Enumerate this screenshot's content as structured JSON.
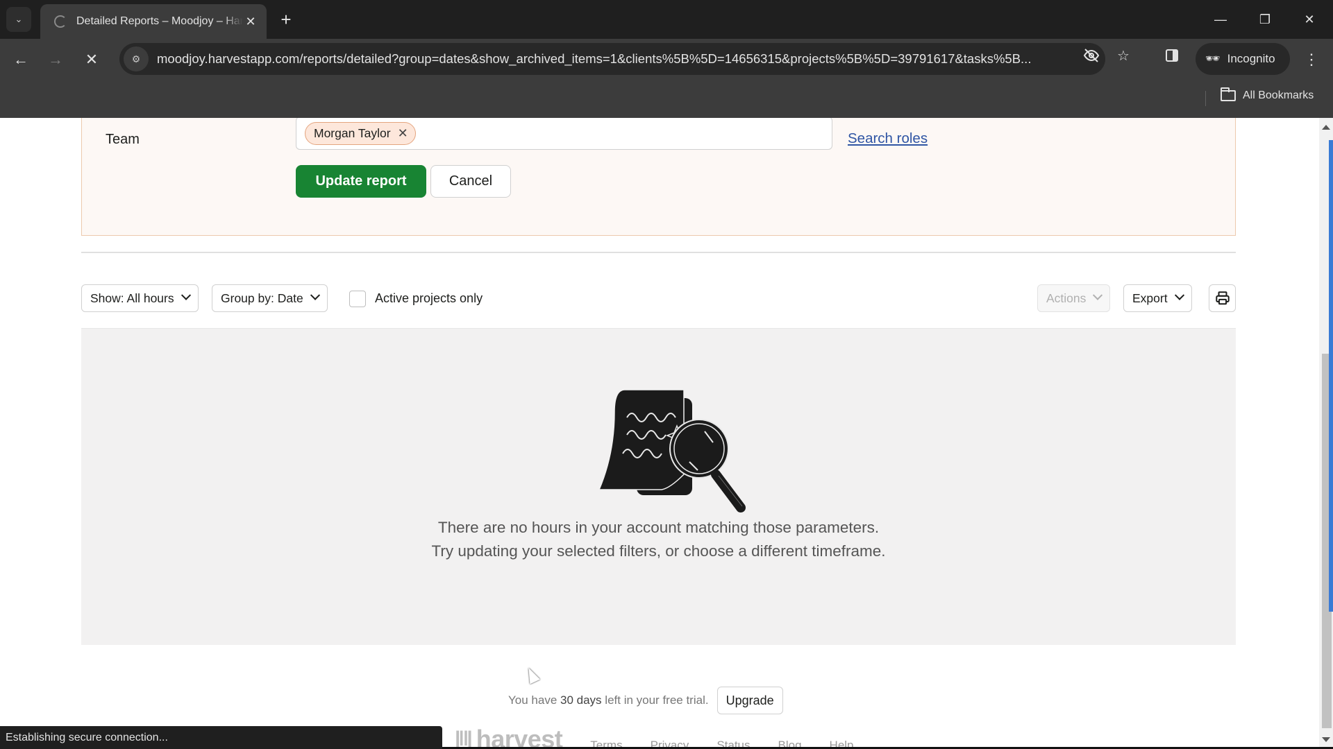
{
  "browser": {
    "tab": {
      "title": "Detailed Reports – Moodjoy – Harvest",
      "close_label": "✕"
    },
    "new_tab_label": "+",
    "window_controls": {
      "minimize": "—",
      "restore": "❐",
      "close": "✕"
    },
    "nav": {
      "back": "←",
      "forward": "→",
      "stop": "✕"
    },
    "url": "moodjoy.harvestapp.com/reports/detailed?group=dates&show_archived_items=1&clients%5B%5D=14656315&projects%5B%5D=39791617&tasks%5B...",
    "incognito_label": "Incognito",
    "all_bookmarks_label": "All Bookmarks",
    "status_text": "Establishing secure connection..."
  },
  "filters": {
    "team_label": "Team",
    "team_selected": [
      {
        "name": "Morgan Taylor",
        "remove_label": "✕"
      }
    ],
    "search_roles_link": "Search roles",
    "update_button": "Update report",
    "cancel_button": "Cancel"
  },
  "report_toolbar": {
    "show_dropdown": "Show: All hours",
    "group_dropdown": "Group by: Date",
    "active_projects_label": "Active projects only",
    "active_projects_checked": false,
    "actions_dropdown": "Actions",
    "actions_disabled": true,
    "export_dropdown": "Export",
    "print_icon": "printer-icon"
  },
  "empty_state": {
    "icon": "document-search-icon",
    "line1": "There are no hours in your account matching those parameters.",
    "line2": "Try updating your selected filters, or choose a different timeframe."
  },
  "trial": {
    "prefix": "You have",
    "days": "30 days",
    "suffix": "left in your free trial.",
    "upgrade_button": "Upgrade"
  },
  "footer": {
    "logo_text": "harvest",
    "links": [
      "Terms",
      "Privacy",
      "Status",
      "Blog",
      "Help"
    ]
  },
  "colors": {
    "primary_green": "#188433",
    "link_blue": "#2f55a4",
    "chip_bg": "#fde7db",
    "panel_bg": "#fdf8f5",
    "scroll_thumb": "#3a7bd5"
  }
}
